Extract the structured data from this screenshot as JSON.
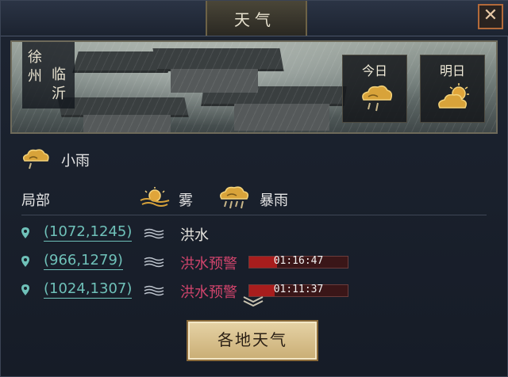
{
  "window": {
    "title": "天气",
    "close_glyph": "✕"
  },
  "location": {
    "col1": [
      "徐",
      "州"
    ],
    "col2": [
      "临",
      "沂"
    ]
  },
  "forecast": {
    "today_label": "今日",
    "today_icon": "cloud-rain-icon",
    "tomorrow_label": "明日",
    "tomorrow_icon": "sun-cloud-icon"
  },
  "current": {
    "icon": "cloud-rain-icon",
    "label": "小雨"
  },
  "local": {
    "label": "局部",
    "weathers": [
      {
        "icon": "fog-sun-icon",
        "label": "雾"
      },
      {
        "icon": "storm-cloud-icon",
        "label": "暴雨"
      }
    ]
  },
  "events": [
    {
      "coord": "(1072,1245)",
      "status": "洪水",
      "warning": false
    },
    {
      "coord": "(966,1279)",
      "status": "洪水预警",
      "warning": true,
      "timer": "01:16:47",
      "progress": 0.28
    },
    {
      "coord": "(1024,1307)",
      "status": "洪水预警",
      "warning": true,
      "timer": "01:11:37",
      "progress": 0.26
    }
  ],
  "more_icon": "chevron-down-icon",
  "button": {
    "label": "各地天气"
  },
  "colors": {
    "accent_gold": "#c9ad74",
    "warning": "#d1446c",
    "coord": "#6fc1b9",
    "bar_fill": "#a81d1d"
  }
}
